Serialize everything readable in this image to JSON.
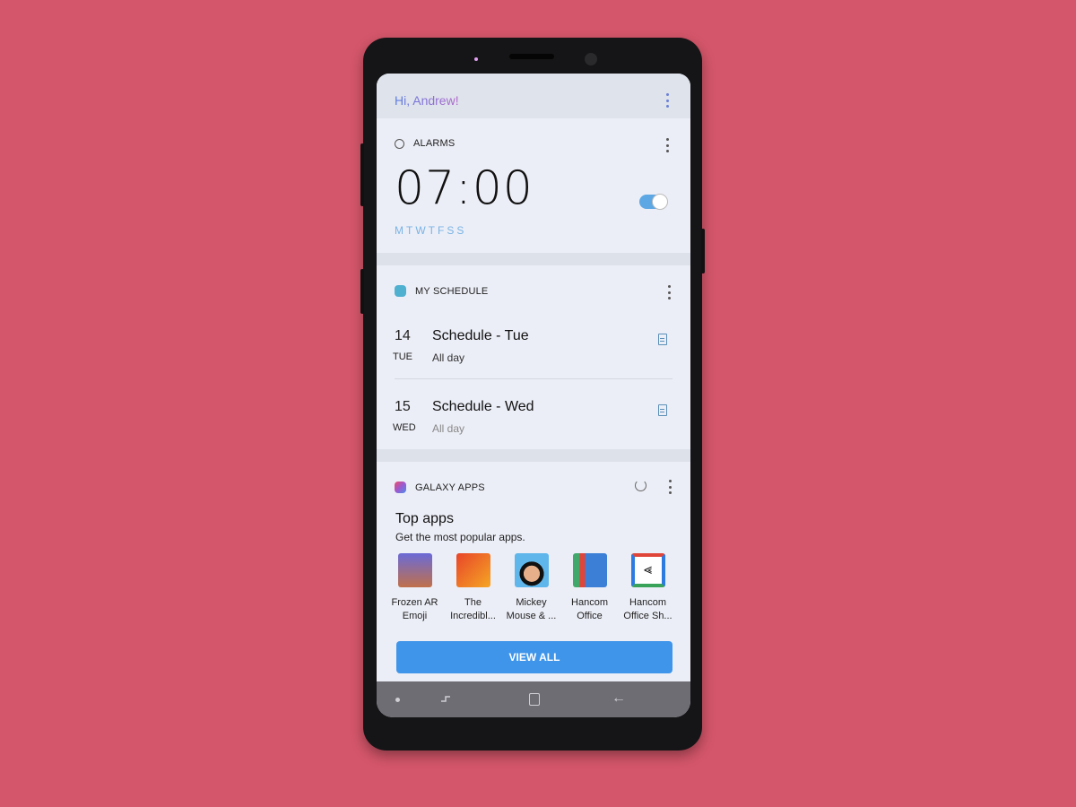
{
  "greeting": "Hi, Andrew!",
  "alarms": {
    "title": "ALARMS",
    "time": "07:00",
    "days": "MTWTFSS",
    "enabled": true,
    "accent_color": "#5da8e4"
  },
  "schedule": {
    "title": "MY SCHEDULE",
    "items": [
      {
        "day_num": "14",
        "day_name": "TUE",
        "title": "Schedule - Tue",
        "subtitle": "All day"
      },
      {
        "day_num": "15",
        "day_name": "WED",
        "title": "Schedule - Wed",
        "subtitle": "All day"
      }
    ]
  },
  "galaxy_apps": {
    "title": "GALAXY APPS",
    "heading": "Top apps",
    "subheading": "Get the most popular apps.",
    "apps": [
      {
        "name": "Frozen AR Emoji"
      },
      {
        "name": "The Incredibl..."
      },
      {
        "name": "Mickey Mouse & ..."
      },
      {
        "name": "Hancom Office"
      },
      {
        "name": "Hancom Office Sh..."
      }
    ],
    "view_all_label": "VIEW ALL",
    "button_color": "#3f95ea"
  }
}
